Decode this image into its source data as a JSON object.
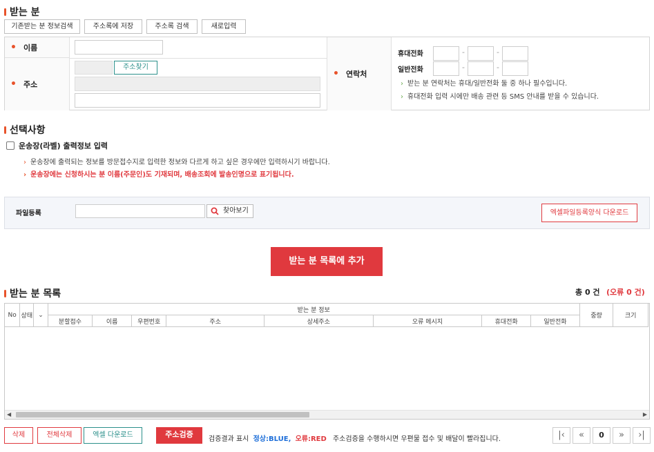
{
  "recipient": {
    "title": "받는 분",
    "buttons": [
      "기존받는 분 정보검색",
      "주소록에 저장",
      "주소록 검색",
      "새로입력"
    ],
    "name_label": "이름",
    "address_label": "주소",
    "address_search": "주소찾기",
    "contact_label": "연락처",
    "mobile_label": "휴대전화",
    "phone_label": "일반전화",
    "dash": "-",
    "hint1": "받는 분 연락처는 휴대/일반전화 둘 중 하나 필수입니다.",
    "hint2": "휴대전화 입력 시에만 배송 관련 등 SMS 안내를 받을 수 있습니다."
  },
  "options": {
    "title": "선택사항",
    "checkbox_label": "운송장(라벨) 출력정보 입력",
    "note1": "운송장에 출력되는 정보를 방문접수지로 입력한 정보와 다르게 하고 싶은 경우에만 입력하시기 바랍니다.",
    "note2": "운송장에는 신청하시는 분 이름(주문인)도 기재되며, 배송조회에 발송인명으로 표기됩니다."
  },
  "file": {
    "label": "파일등록",
    "find_label": "찾아보기",
    "download_label": "엑셀파일등록양식 다운로드"
  },
  "add_button": "받는 분 목록에 추가",
  "list": {
    "title": "받는 분 목록",
    "total": "총 0 건",
    "errors": "(오류 0 건)",
    "headers_top": [
      "No",
      "상태",
      "받는 분 정보",
      "중량",
      "크기"
    ],
    "headers_sub": [
      "분할접수",
      "이름",
      "우편번호",
      "주소",
      "상세주소",
      "오류 메시지",
      "휴대전화",
      "일반전화"
    ]
  },
  "bottom": {
    "delete": "삭제",
    "delete_all": "전체삭제",
    "excel_download": "엑셀 다운로드",
    "verify": "주소검증",
    "result_prefix": "검증결과 표시",
    "normal": "정상:BLUE,",
    "error": "오류:RED",
    "result_note": "주소검증을 수행하시면 우편물 접수 및 배달이 빨라집니다.",
    "page": "0"
  },
  "colors": {
    "accent": "#e8532b",
    "primary_red": "#e0393e",
    "blue": "#1e6fd9",
    "teal": "#2a8f8a"
  }
}
